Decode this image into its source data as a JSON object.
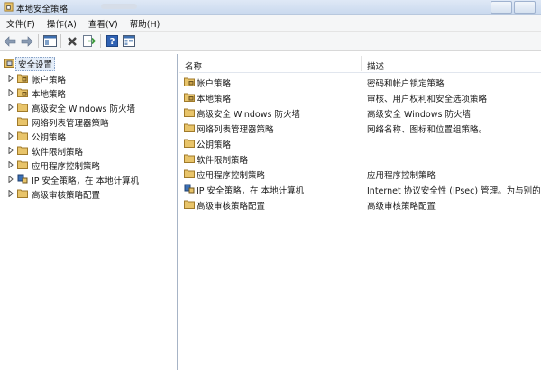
{
  "window": {
    "title": "本地安全策略"
  },
  "menu": [
    {
      "label": "文件(F)"
    },
    {
      "label": "操作(A)"
    },
    {
      "label": "查看(V)"
    },
    {
      "label": "帮助(H)"
    }
  ],
  "toolbar": {
    "icons": [
      "back-arrow-icon",
      "forward-arrow-icon",
      "show-hide-tree-icon",
      "delete-icon",
      "export-list-icon",
      "help-icon",
      "properties-icon"
    ]
  },
  "tree": {
    "root": {
      "label": "安全设置",
      "icon": "security-settings-icon"
    },
    "items": [
      {
        "label": "帐户策略",
        "icon": "lock-folder-icon",
        "expandable": true
      },
      {
        "label": "本地策略",
        "icon": "lock-folder-icon",
        "expandable": true
      },
      {
        "label": "高级安全 Windows 防火墙",
        "icon": "folder-icon",
        "expandable": true
      },
      {
        "label": "网络列表管理器策略",
        "icon": "folder-icon",
        "expandable": false
      },
      {
        "label": "公钥策略",
        "icon": "folder-icon",
        "expandable": true
      },
      {
        "label": "软件限制策略",
        "icon": "folder-icon",
        "expandable": true
      },
      {
        "label": "应用程序控制策略",
        "icon": "folder-icon",
        "expandable": true
      },
      {
        "label": "IP 安全策略，在 本地计算机",
        "icon": "ip-security-icon",
        "expandable": true
      },
      {
        "label": "高级审核策略配置",
        "icon": "folder-icon",
        "expandable": true
      }
    ]
  },
  "list": {
    "columns": {
      "name": "名称",
      "description": "描述"
    },
    "rows": [
      {
        "name": "帐户策略",
        "description": "密码和帐户锁定策略",
        "icon": "lock-folder-icon"
      },
      {
        "name": "本地策略",
        "description": "审核、用户权利和安全选项策略",
        "icon": "lock-folder-icon"
      },
      {
        "name": "高级安全 Windows 防火墙",
        "description": "高级安全 Windows 防火墙",
        "icon": "folder-icon"
      },
      {
        "name": "网络列表管理器策略",
        "description": "网络名称、图标和位置组策略。",
        "icon": "folder-icon"
      },
      {
        "name": "公钥策略",
        "description": "",
        "icon": "folder-icon"
      },
      {
        "name": "软件限制策略",
        "description": "",
        "icon": "folder-icon"
      },
      {
        "name": "应用程序控制策略",
        "description": "应用程序控制策略",
        "icon": "folder-icon"
      },
      {
        "name": "IP 安全策略，在 本地计算机",
        "description": "Internet 协议安全性 (IPsec) 管理。为与别的",
        "icon": "ip-security-icon"
      },
      {
        "name": "高级审核策略配置",
        "description": "高级审核策略配置",
        "icon": "folder-icon"
      }
    ]
  },
  "colors": {
    "folder": "#e8c46a",
    "lock": "#c8a14a",
    "selection": "#e5eef9"
  }
}
